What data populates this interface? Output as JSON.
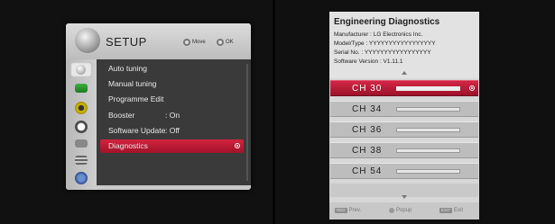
{
  "setup": {
    "title": "SETUP",
    "hints": {
      "move": "Move",
      "ok": "OK"
    },
    "side_icons": [
      "satellite-dish-icon",
      "picture-icon",
      "audio-icon",
      "clock-icon",
      "lock-icon",
      "option-icon",
      "usb-icon"
    ],
    "items": [
      {
        "label": "Auto tuning",
        "value": ""
      },
      {
        "label": "Manual tuning",
        "value": ""
      },
      {
        "label": "Programme Edit",
        "value": ""
      },
      {
        "label": "Booster",
        "value": ": On"
      },
      {
        "label": "Software Update",
        "value": ": Off"
      },
      {
        "label": "Diagnostics",
        "value": ""
      }
    ],
    "selected_index": 5
  },
  "diagnostics": {
    "title": "Engineering Diagnostics",
    "manufacturer": "Manufacturer : LG Electronics Inc.",
    "model": "Model/Type : YYYYYYYYYYYYYYYYY",
    "serial": "Serial No. : YYYYYYYYYYYYYYYYY",
    "software_version": "Software Version : V1.11.1",
    "channels": [
      "CH  30",
      "CH  34",
      "CH  36",
      "CH  38",
      "CH  54"
    ],
    "selected_channel": 0,
    "footer": {
      "prev_key": "RED",
      "prev_label": "Prev.",
      "popup_label": "Popup",
      "exit_key": "EXIT",
      "exit_label": "Exit"
    }
  },
  "colors": {
    "highlight": "#c01d37",
    "menu_dark": "#3a3a3a",
    "panel_grey": "#d7d7d7"
  }
}
